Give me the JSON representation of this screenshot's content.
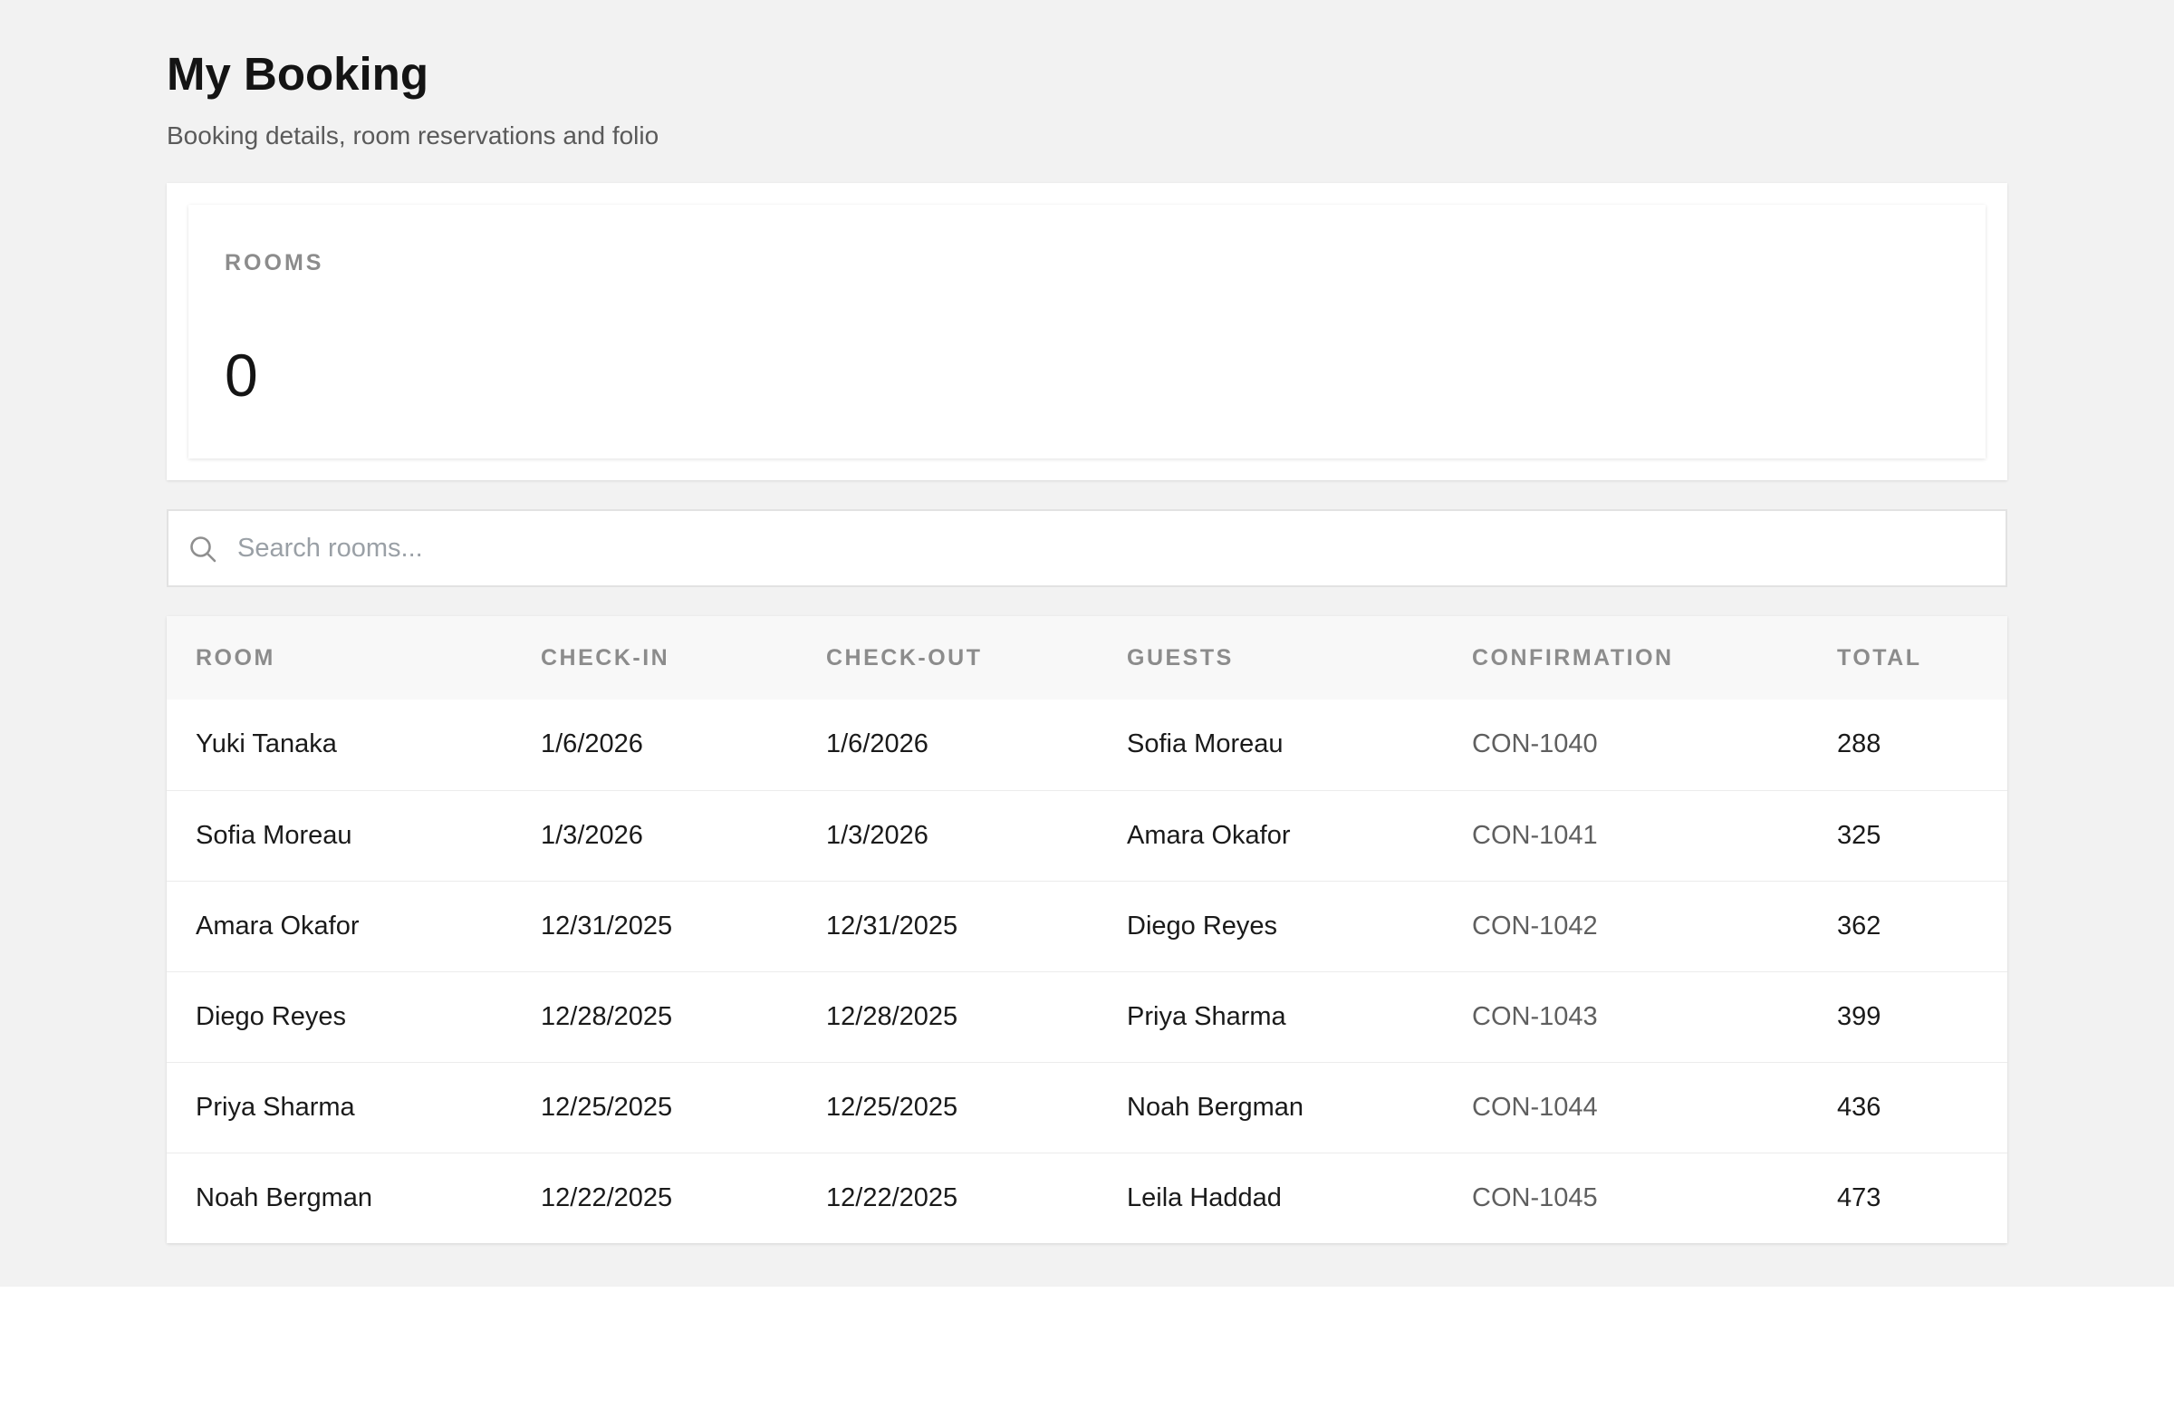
{
  "header": {
    "title": "My Booking",
    "subtitle": "Booking details, room reservations and folio"
  },
  "stats": {
    "rooms_label": "ROOMS",
    "rooms_value": "0"
  },
  "search": {
    "placeholder": "Search rooms...",
    "value": "",
    "icon": "search-icon"
  },
  "table": {
    "columns": [
      "ROOM",
      "CHECK-IN",
      "CHECK-OUT",
      "GUESTS",
      "CONFIRMATION",
      "TOTAL"
    ],
    "rows": [
      {
        "room": "Yuki Tanaka",
        "check_in": "1/6/2026",
        "check_out": "1/6/2026",
        "guests": "Sofia Moreau",
        "confirmation": "CON-1040",
        "total": "288"
      },
      {
        "room": "Sofia Moreau",
        "check_in": "1/3/2026",
        "check_out": "1/3/2026",
        "guests": "Amara Okafor",
        "confirmation": "CON-1041",
        "total": "325"
      },
      {
        "room": "Amara Okafor",
        "check_in": "12/31/2025",
        "check_out": "12/31/2025",
        "guests": "Diego Reyes",
        "confirmation": "CON-1042",
        "total": "362"
      },
      {
        "room": "Diego Reyes",
        "check_in": "12/28/2025",
        "check_out": "12/28/2025",
        "guests": "Priya Sharma",
        "confirmation": "CON-1043",
        "total": "399"
      },
      {
        "room": "Priya Sharma",
        "check_in": "12/25/2025",
        "check_out": "12/25/2025",
        "guests": "Noah Bergman",
        "confirmation": "CON-1044",
        "total": "436"
      },
      {
        "room": "Noah Bergman",
        "check_in": "12/22/2025",
        "check_out": "12/22/2025",
        "guests": "Leila Haddad",
        "confirmation": "CON-1045",
        "total": "473"
      }
    ]
  },
  "colors": {
    "page_background": "#f2f2f2",
    "card_background": "#ffffff",
    "muted_text": "#8c8c8c"
  }
}
